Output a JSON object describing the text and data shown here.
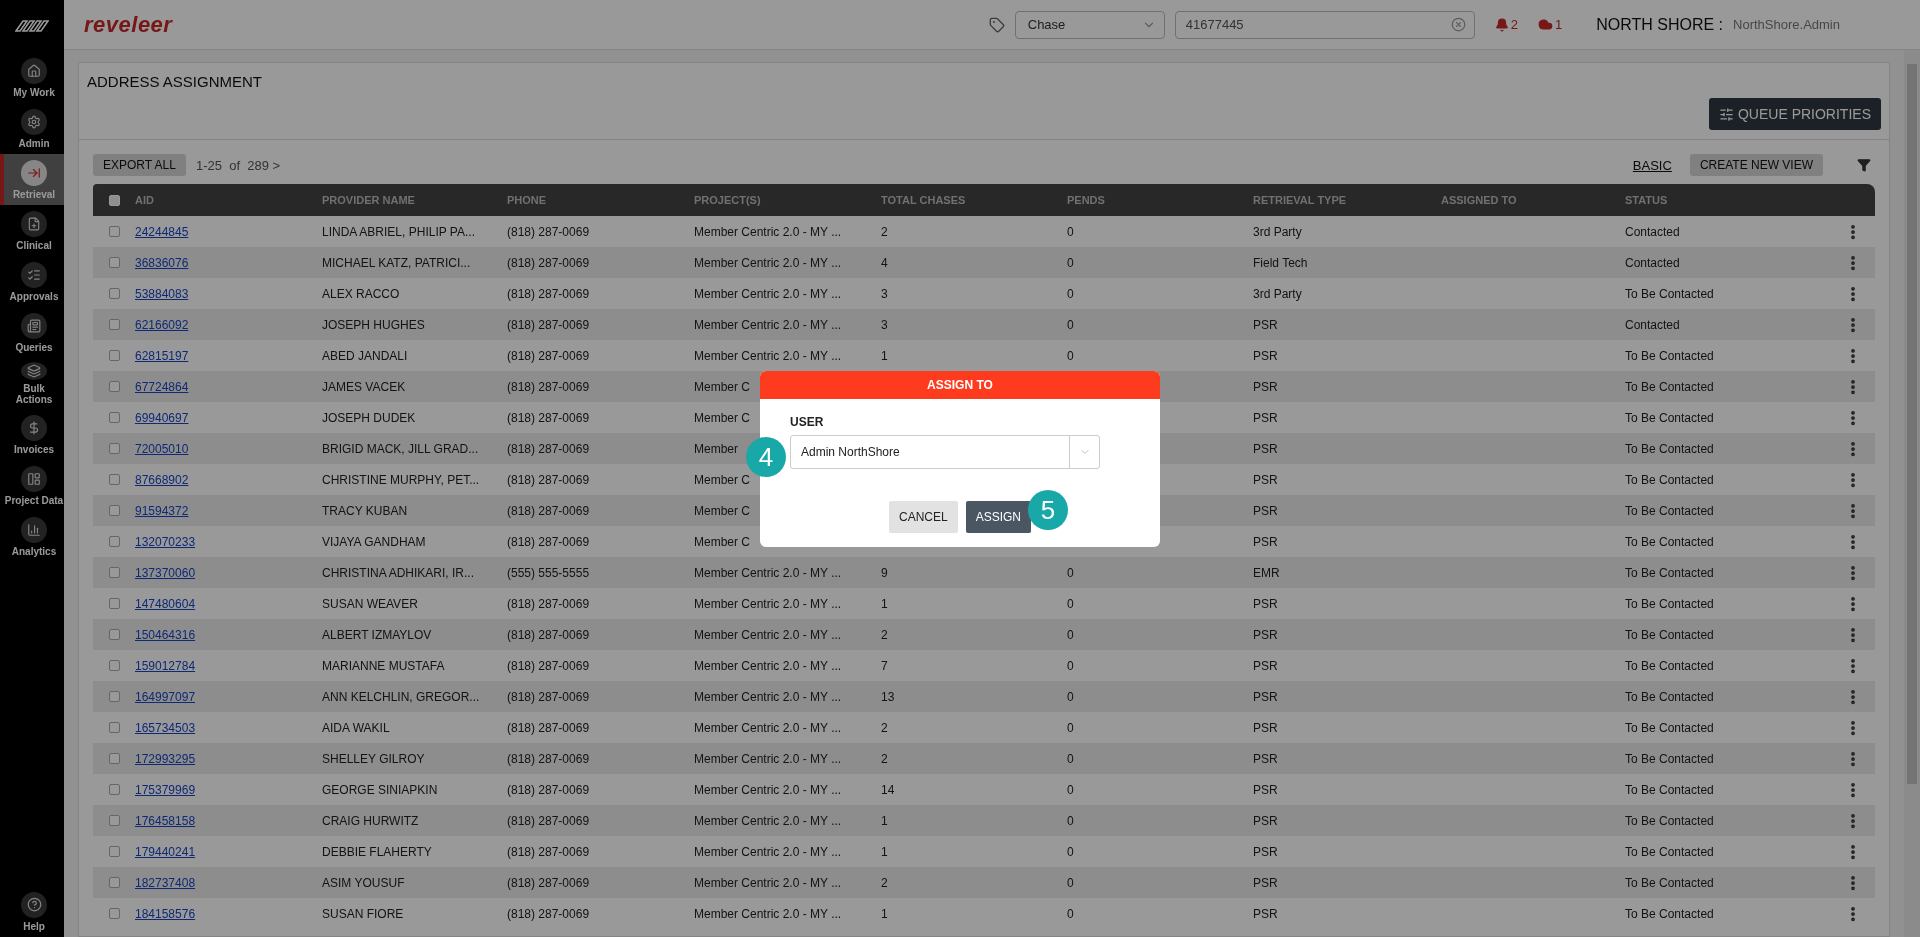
{
  "app": {
    "brand": "reveleer"
  },
  "sidebar": {
    "items": [
      {
        "label": "My Work",
        "selected": false
      },
      {
        "label": "Admin",
        "selected": false
      },
      {
        "label": "Retrieval",
        "selected": true
      },
      {
        "label": "Clinical",
        "selected": false
      },
      {
        "label": "Approvals",
        "selected": false
      },
      {
        "label": "Queries",
        "selected": false
      },
      {
        "label": "Bulk Actions",
        "selected": false
      },
      {
        "label": "Invoices",
        "selected": false
      },
      {
        "label": "Project Data",
        "selected": false
      },
      {
        "label": "Analytics",
        "selected": false
      }
    ],
    "help": {
      "label": "Help"
    }
  },
  "header": {
    "search_type": "Chase",
    "search_value": "41677445",
    "alerts": "2",
    "cloud_alerts": "1",
    "org": "NORTH SHORE :",
    "user": "NorthShore.Admin"
  },
  "page": {
    "title": "ADDRESS ASSIGNMENT",
    "queue_button": "QUEUE PRIORITIES",
    "export_button": "EXPORT ALL",
    "pagination": "1-25  of  289 >",
    "view_link": "BASIC",
    "create_view_button": "CREATE NEW VIEW"
  },
  "table": {
    "select_all": {
      "checked": false
    },
    "columns": [
      "AID",
      "PROVIDER NAME",
      "PHONE",
      "PROJECT(S)",
      "TOTAL CHASES",
      "PENDS",
      "RETRIEVAL TYPE",
      "ASSIGNED TO",
      "STATUS"
    ],
    "rows": [
      {
        "checked": false,
        "aid": "24244845",
        "provider": "LINDA ABRIEL, PHILIP PA...",
        "phone": "(818) 287-0069",
        "project": "Member Centric 2.0 - MY ...",
        "total": "2",
        "pends": "0",
        "type": "3rd Party",
        "status": "Contacted"
      },
      {
        "checked": false,
        "aid": "36836076",
        "provider": "MICHAEL KATZ, PATRICI...",
        "phone": "(818) 287-0069",
        "project": "Member Centric 2.0 - MY ...",
        "total": "4",
        "pends": "0",
        "type": "Field Tech",
        "status": "Contacted"
      },
      {
        "checked": false,
        "aid": "53884083",
        "provider": "ALEX RACCO",
        "phone": "(818) 287-0069",
        "project": "Member Centric 2.0 - MY ...",
        "total": "3",
        "pends": "0",
        "type": "3rd Party",
        "status": "To Be Contacted"
      },
      {
        "checked": false,
        "aid": "62166092",
        "provider": "JOSEPH HUGHES",
        "phone": "(818) 287-0069",
        "project": "Member Centric 2.0 - MY ...",
        "total": "3",
        "pends": "0",
        "type": "PSR",
        "status": "Contacted"
      },
      {
        "checked": false,
        "aid": "62815197",
        "provider": "ABED JANDALI",
        "phone": "(818) 287-0069",
        "project": "Member Centric 2.0 - MY ...",
        "total": "1",
        "pends": "0",
        "type": "PSR",
        "status": "To Be Contacted"
      },
      {
        "checked": false,
        "aid": "67724864",
        "provider": "JAMES VACEK",
        "phone": "(818) 287-0069",
        "project": "Member C",
        "type": "PSR",
        "status": "To Be Contacted"
      },
      {
        "checked": false,
        "aid": "69940697",
        "provider": "JOSEPH DUDEK",
        "phone": "(818) 287-0069",
        "project": "Member C",
        "type": "PSR",
        "status": "To Be Contacted"
      },
      {
        "checked": false,
        "aid": "72005010",
        "provider": "BRIGID MACK, JILL GRAD...",
        "phone": "(818) 287-0069",
        "project": "Member",
        "type": "PSR",
        "status": "To Be Contacted"
      },
      {
        "checked": false,
        "aid": "87668902",
        "provider": "CHRISTINE MURPHY, PET...",
        "phone": "(818) 287-0069",
        "project": "Member C",
        "type": "PSR",
        "status": "To Be Contacted"
      },
      {
        "checked": false,
        "aid": "91594372",
        "provider": "TRACY KUBAN",
        "phone": "(818) 287-0069",
        "project": "Member C",
        "type": "PSR",
        "status": "To Be Contacted"
      },
      {
        "checked": false,
        "aid": "132070233",
        "provider": "VIJAYA GANDHAM",
        "phone": "(818) 287-0069",
        "project": "Member C",
        "type": "PSR",
        "status": "To Be Contacted"
      },
      {
        "checked": false,
        "aid": "137370060",
        "provider": "CHRISTINA ADHIKARI, IR...",
        "phone": "(555) 555-5555",
        "project": "Member Centric 2.0 - MY ...",
        "total": "9",
        "pends": "0",
        "type": "EMR",
        "status": "To Be Contacted"
      },
      {
        "checked": false,
        "aid": "147480604",
        "provider": "SUSAN WEAVER",
        "phone": "(818) 287-0069",
        "project": "Member Centric 2.0 - MY ...",
        "total": "1",
        "pends": "0",
        "type": "PSR",
        "status": "To Be Contacted"
      },
      {
        "checked": false,
        "aid": "150464316",
        "provider": "ALBERT IZMAYLOV",
        "phone": "(818) 287-0069",
        "project": "Member Centric 2.0 - MY ...",
        "total": "2",
        "pends": "0",
        "type": "PSR",
        "status": "To Be Contacted"
      },
      {
        "checked": false,
        "aid": "159012784",
        "provider": "MARIANNE MUSTAFA",
        "phone": "(818) 287-0069",
        "project": "Member Centric 2.0 - MY ...",
        "total": "7",
        "pends": "0",
        "type": "PSR",
        "status": "To Be Contacted"
      },
      {
        "checked": false,
        "aid": "164997097",
        "provider": "ANN KELCHLIN, GREGOR...",
        "phone": "(818) 287-0069",
        "project": "Member Centric 2.0 - MY ...",
        "total": "13",
        "pends": "0",
        "type": "PSR",
        "status": "To Be Contacted"
      },
      {
        "checked": false,
        "aid": "165734503",
        "provider": "AIDA WAKIL",
        "phone": "(818) 287-0069",
        "project": "Member Centric 2.0 - MY ...",
        "total": "2",
        "pends": "0",
        "type": "PSR",
        "status": "To Be Contacted"
      },
      {
        "checked": false,
        "aid": "172993295",
        "provider": "SHELLEY GILROY",
        "phone": "(818) 287-0069",
        "project": "Member Centric 2.0 - MY ...",
        "total": "2",
        "pends": "0",
        "type": "PSR",
        "status": "To Be Contacted"
      },
      {
        "checked": false,
        "aid": "175379969",
        "provider": "GEORGE SINIAPKIN",
        "phone": "(818) 287-0069",
        "project": "Member Centric 2.0 - MY ...",
        "total": "14",
        "pends": "0",
        "type": "PSR",
        "status": "To Be Contacted"
      },
      {
        "checked": false,
        "aid": "176458158",
        "provider": "CRAIG HURWITZ",
        "phone": "(818) 287-0069",
        "project": "Member Centric 2.0 - MY ...",
        "total": "1",
        "pends": "0",
        "type": "PSR",
        "status": "To Be Contacted"
      },
      {
        "checked": false,
        "aid": "179440241",
        "provider": "DEBBIE FLAHERTY",
        "phone": "(818) 287-0069",
        "project": "Member Centric 2.0 - MY ...",
        "total": "1",
        "pends": "0",
        "type": "PSR",
        "status": "To Be Contacted"
      },
      {
        "checked": false,
        "aid": "182737408",
        "provider": "ASIM YOUSUF",
        "phone": "(818) 287-0069",
        "project": "Member Centric 2.0 - MY ...",
        "total": "2",
        "pends": "0",
        "type": "PSR",
        "status": "To Be Contacted"
      },
      {
        "checked": false,
        "aid": "184158576",
        "provider": "SUSAN FIORE",
        "phone": "(818) 287-0069",
        "project": "Member Centric 2.0 - MY ...",
        "total": "1",
        "pends": "0",
        "type": "PSR",
        "status": "To Be Contacted"
      }
    ]
  },
  "dialog": {
    "title": "ASSIGN TO",
    "field_label": "USER",
    "user_value": "Admin NorthShore",
    "cancel": "CANCEL",
    "assign": "ASSIGN",
    "step_badges": [
      "4",
      "5"
    ]
  }
}
